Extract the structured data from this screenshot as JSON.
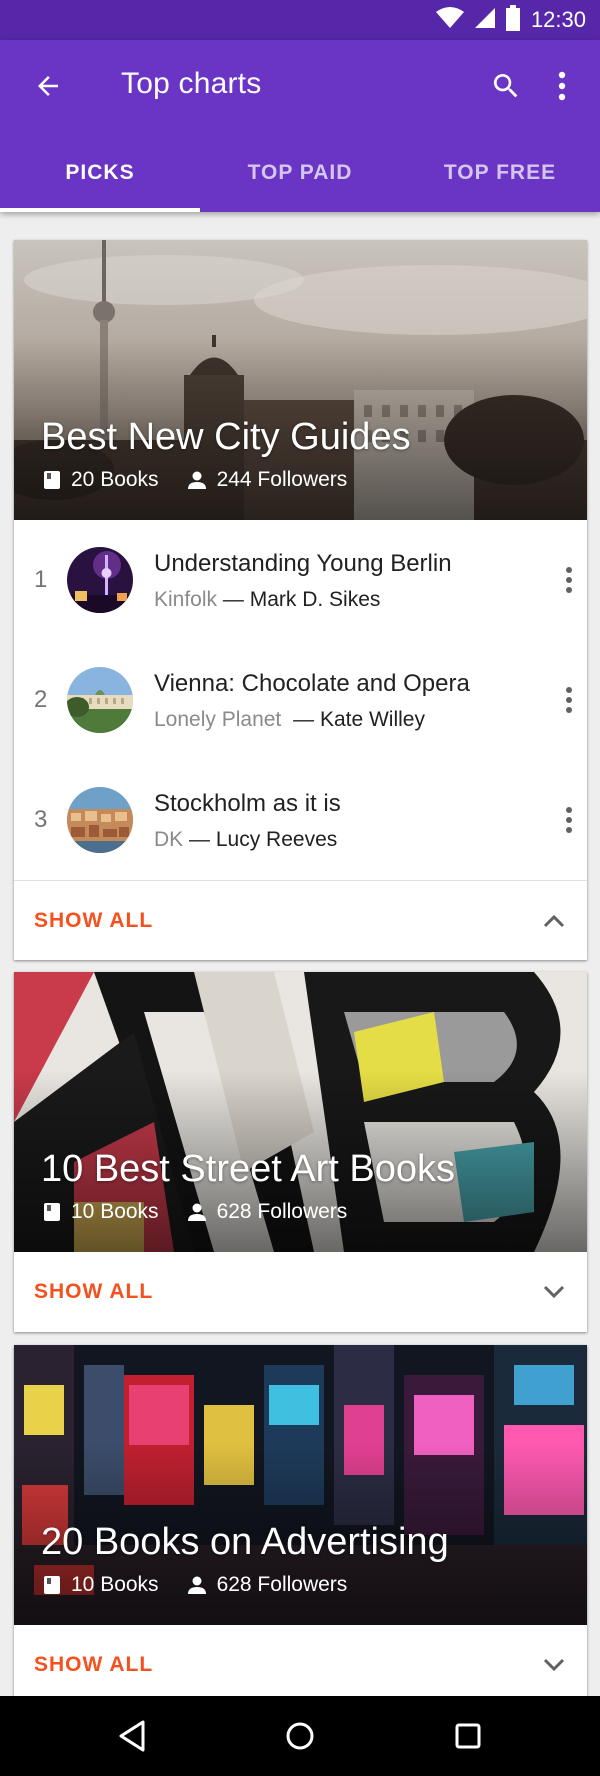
{
  "status": {
    "time": "12:30"
  },
  "header": {
    "title": "Top charts"
  },
  "tabs": [
    {
      "label": "PICKS",
      "active": true
    },
    {
      "label": "TOP PAID",
      "active": false
    },
    {
      "label": "TOP FREE",
      "active": false
    }
  ],
  "collections": [
    {
      "title": "Best New City Guides",
      "books": "20 Books",
      "followers": "244 Followers",
      "expanded": true,
      "items": [
        {
          "rank": "1",
          "title": "Understanding Young Berlin",
          "publisher": "Kinfolk",
          "author": "— Mark D. Sikes"
        },
        {
          "rank": "2",
          "title": "Vienna: Chocolate and Opera",
          "publisher": "Lonely Planet",
          "author": "— Kate Willey"
        },
        {
          "rank": "3",
          "title": "Stockholm as it is",
          "publisher": "DK",
          "author": "— Lucy Reeves"
        }
      ],
      "show_all": "SHOW ALL"
    },
    {
      "title": "10 Best Street Art Books",
      "books": "10 Books",
      "followers": "628 Followers",
      "expanded": false,
      "show_all": "SHOW ALL"
    },
    {
      "title": "20 Books on Advertising",
      "books": "10 Books",
      "followers": "628 Followers",
      "expanded": false,
      "show_all": "SHOW ALL"
    }
  ],
  "colors": {
    "status_bar": "#5727a9",
    "app_bar": "#6a34c5",
    "accent": "#f4511e"
  },
  "icons": [
    "wifi-icon",
    "signal-icon",
    "battery-icon",
    "back-arrow-icon",
    "search-icon",
    "more-vert-icon",
    "book-icon",
    "person-icon",
    "chevron-up-icon",
    "chevron-down-icon",
    "nav-back-icon",
    "nav-home-icon",
    "nav-recents-icon"
  ]
}
